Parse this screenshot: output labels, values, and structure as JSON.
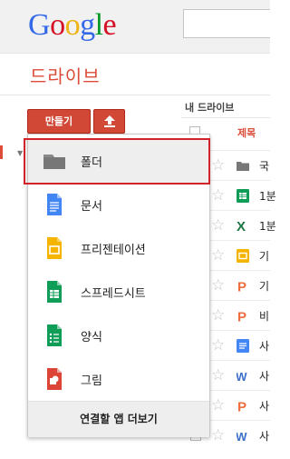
{
  "header": {
    "logo": {
      "letters": [
        {
          "char": "G",
          "color": "#3369e8"
        },
        {
          "char": "o",
          "color": "#d50f25"
        },
        {
          "char": "o",
          "color": "#eeb211"
        },
        {
          "char": "g",
          "color": "#3369e8"
        },
        {
          "char": "l",
          "color": "#009925"
        },
        {
          "char": "e",
          "color": "#d50f25"
        }
      ]
    },
    "app_title": "드라이브"
  },
  "toolbar": {
    "create_label": "만들기",
    "upload_icon": "upload-arrow-icon"
  },
  "file_list": {
    "breadcrumb": "내 드라이브",
    "column_title": "제목",
    "rows": [
      {
        "icon": "folder-icon",
        "name": "국",
        "color": "#777777"
      },
      {
        "icon": "sheets-icon",
        "name": "1분",
        "color": "#0f9d58"
      },
      {
        "icon": "excel-icon",
        "name": "1분",
        "color": "#1d7544"
      },
      {
        "icon": "slides-icon",
        "name": "기",
        "color": "#f4b400"
      },
      {
        "icon": "powerpoint-icon",
        "name": "기",
        "color": "#ee6c3d"
      },
      {
        "icon": "powerpoint-icon",
        "name": "비",
        "color": "#ee6c3d"
      },
      {
        "icon": "docs-icon",
        "name": "사",
        "color": "#4285f4"
      },
      {
        "icon": "word-icon",
        "name": "사",
        "color": "#3b6fc9"
      },
      {
        "icon": "powerpoint-icon",
        "name": "사",
        "color": "#ee6c3d"
      },
      {
        "icon": "word-icon",
        "name": "사",
        "color": "#3b6fc9"
      }
    ]
  },
  "create_menu": {
    "items": [
      {
        "label": "폴더",
        "icon": "folder-icon",
        "color": "#8a8a8a",
        "highlighted": true
      },
      {
        "label": "문서",
        "icon": "docs-icon",
        "color": "#4285f4"
      },
      {
        "label": "프리젠테이션",
        "icon": "slides-icon",
        "color": "#f4b400"
      },
      {
        "label": "스프레드시트",
        "icon": "sheets-icon",
        "color": "#0f9d58"
      },
      {
        "label": "양식",
        "icon": "forms-icon",
        "color": "#0f9d58"
      },
      {
        "label": "그림",
        "icon": "drawings-icon",
        "color": "#db4437"
      }
    ],
    "footer_label": "연결할 앱 더보기"
  }
}
